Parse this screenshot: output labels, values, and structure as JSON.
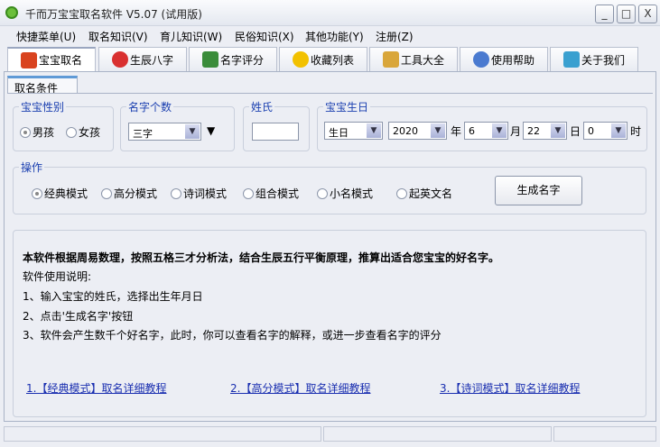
{
  "window": {
    "title": "千而万宝宝取名软件 V5.07 (试用版)",
    "minimize": "_",
    "maximize": "□",
    "close": "X"
  },
  "menu": [
    "快捷菜单(U)",
    "取名知识(V)",
    "育儿知识(W)",
    "民俗知识(X)",
    "其他功能(Y)",
    "注册(Z)"
  ],
  "tabs": [
    {
      "label": "宝宝取名",
      "icon": "house-icon",
      "color": "#d9431f"
    },
    {
      "label": "生辰八字",
      "icon": "molecule-icon",
      "color": "#d93030"
    },
    {
      "label": "名字评分",
      "icon": "person-icon",
      "color": "#3a8c3a"
    },
    {
      "label": "收藏列表",
      "icon": "star-icon",
      "color": "#f2c100"
    },
    {
      "label": "工具大全",
      "icon": "clipboard-icon",
      "color": "#d9a63a"
    },
    {
      "label": "使用帮助",
      "icon": "magnifier-icon",
      "color": "#4a7ad0"
    },
    {
      "label": "关于我们",
      "icon": "chart-icon",
      "color": "#3aa0d0"
    }
  ],
  "subtab": "取名条件",
  "gender": {
    "label": "宝宝性别",
    "options": [
      "男孩",
      "女孩"
    ],
    "selected": 0
  },
  "count": {
    "label": "名字个数",
    "value": "三字",
    "extra": "▼"
  },
  "surname": {
    "label": "姓氏",
    "value": ""
  },
  "birthday": {
    "label": "宝宝生日",
    "type": "生日",
    "year": "2020",
    "year_unit": "年",
    "month": "6",
    "month_unit": "月",
    "day": "22",
    "day_unit": "日",
    "hour": "0",
    "hour_unit": "时"
  },
  "operation": {
    "label": "操作",
    "modes": [
      "经典模式",
      "高分模式",
      "诗词模式",
      "组合模式",
      "小名模式",
      "起英文名"
    ],
    "selected": 0,
    "generate": "生成名字"
  },
  "info": {
    "headline": "本软件根据周易数理，按照五格三才分析法，结合生辰五行平衡原理，推算出适合您宝宝的好名字。",
    "title": "软件使用说明:",
    "steps": [
      "1、输入宝宝的姓氏，选择出生年月日",
      "2、点击'生成名字'按钮",
      "3、软件会产生数千个好名字，此时，你可以查看名字的解释，或进一步查看名字的评分"
    ],
    "links": [
      "1.【经典模式】取名详细教程",
      "2.【高分模式】取名详细教程",
      "3.【诗词模式】取名详细教程"
    ]
  }
}
